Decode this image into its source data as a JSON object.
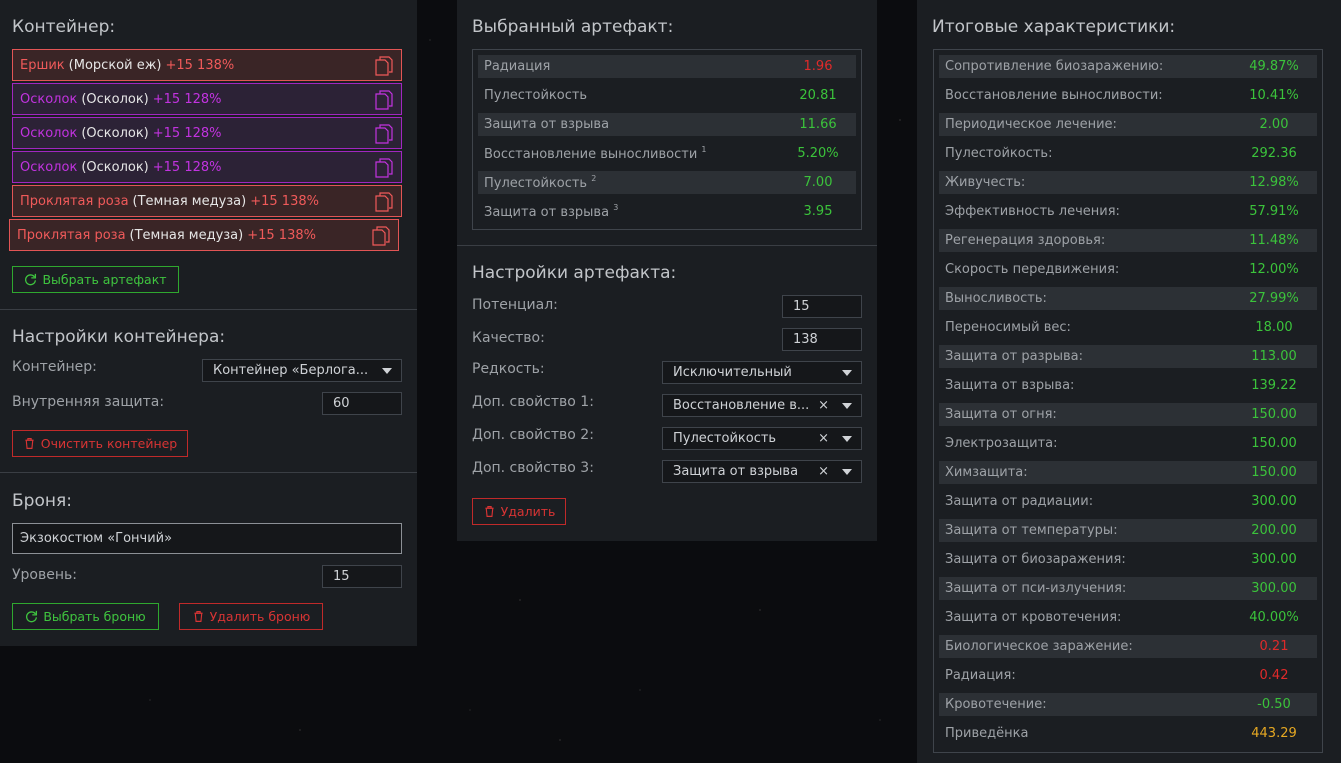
{
  "container_panel": {
    "title": "Контейнер:",
    "artifacts": [
      {
        "name": "Ершик",
        "sub": "(Морской еж)",
        "bonus": "+15 138%",
        "color": "red"
      },
      {
        "name": "Осколок",
        "sub": "(Осколок)",
        "bonus": "+15 128%",
        "color": "purple"
      },
      {
        "name": "Осколок",
        "sub": "(Осколок)",
        "bonus": "+15 128%",
        "color": "purple"
      },
      {
        "name": "Осколок",
        "sub": "(Осколок)",
        "bonus": "+15 128%",
        "color": "purple"
      },
      {
        "name": "Проклятая роза",
        "sub": "(Темная медуза)",
        "bonus": "+15 138%",
        "color": "red"
      },
      {
        "name": "Проклятая роза",
        "sub": "(Темная медуза)",
        "bonus": "+15 138%",
        "color": "red"
      }
    ],
    "select_artifact_label": "Выбрать артефакт",
    "settings_title": "Настройки контейнера:",
    "container_label": "Контейнер:",
    "container_value": "Контейнер «Берлога...",
    "inner_protection_label": "Внутренняя защита:",
    "inner_protection_value": "60",
    "clear_label": "Очистить контейнер",
    "armor_title": "Броня:",
    "armor_value": "Экзокостюм «Гончий»",
    "level_label": "Уровень:",
    "level_value": "15",
    "select_armor_label": "Выбрать броню",
    "delete_armor_label": "Удалить броню"
  },
  "selected_panel": {
    "title": "Выбранный артефакт:",
    "rows": [
      {
        "k": "Радиация",
        "sup": "",
        "v": "1.96",
        "color": "red"
      },
      {
        "k": "Пулестойкость",
        "sup": "",
        "v": "20.81",
        "color": "green"
      },
      {
        "k": "Защита от взрыва",
        "sup": "",
        "v": "11.66",
        "color": "green"
      },
      {
        "k": "Восстановление выносливости",
        "sup": "1",
        "v": "5.20%",
        "color": "green"
      },
      {
        "k": "Пулестойкость",
        "sup": "2",
        "v": "7.00",
        "color": "green"
      },
      {
        "k": "Защита от взрыва",
        "sup": "3",
        "v": "3.95",
        "color": "green"
      }
    ],
    "settings_title": "Настройки артефакта:",
    "potential_label": "Потенциал:",
    "potential_value": "15",
    "quality_label": "Качество:",
    "quality_value": "138",
    "rarity_label": "Редкость:",
    "rarity_value": "Исключительный",
    "prop1_label": "Доп. свойство 1:",
    "prop1_value": "Восстановление в...",
    "prop2_label": "Доп. свойство 2:",
    "prop2_value": "Пулестойкость",
    "prop3_label": "Доп. свойство 3:",
    "prop3_value": "Защита от взрыва",
    "delete_label": "Удалить"
  },
  "totals_panel": {
    "title": "Итоговые характеристики:",
    "rows": [
      {
        "k": "Сопротивление биозаражению:",
        "v": "49.87%",
        "color": "green"
      },
      {
        "k": "Восстановление выносливости:",
        "v": "10.41%",
        "color": "green"
      },
      {
        "k": "Периодическое лечение:",
        "v": "2.00",
        "color": "green"
      },
      {
        "k": "Пулестойкость:",
        "v": "292.36",
        "color": "green"
      },
      {
        "k": "Живучесть:",
        "v": "12.98%",
        "color": "green"
      },
      {
        "k": "Эффективность лечения:",
        "v": "57.91%",
        "color": "green"
      },
      {
        "k": "Регенерация здоровья:",
        "v": "11.48%",
        "color": "green"
      },
      {
        "k": "Скорость передвижения:",
        "v": "12.00%",
        "color": "green"
      },
      {
        "k": "Выносливость:",
        "v": "27.99%",
        "color": "green"
      },
      {
        "k": "Переносимый вес:",
        "v": "18.00",
        "color": "green"
      },
      {
        "k": "Защита от разрыва:",
        "v": "113.00",
        "color": "green"
      },
      {
        "k": "Защита от взрыва:",
        "v": "139.22",
        "color": "green"
      },
      {
        "k": "Защита от огня:",
        "v": "150.00",
        "color": "green"
      },
      {
        "k": "Электрозащита:",
        "v": "150.00",
        "color": "green"
      },
      {
        "k": "Химзащита:",
        "v": "150.00",
        "color": "green"
      },
      {
        "k": "Защита от радиации:",
        "v": "300.00",
        "color": "green"
      },
      {
        "k": "Защита от температуры:",
        "v": "200.00",
        "color": "green"
      },
      {
        "k": "Защита от биозаражения:",
        "v": "300.00",
        "color": "green"
      },
      {
        "k": "Защита от пси-излучения:",
        "v": "300.00",
        "color": "green"
      },
      {
        "k": "Защита от кровотечения:",
        "v": "40.00%",
        "color": "green"
      },
      {
        "k": "Биологическое заражение:",
        "v": "0.21",
        "color": "red"
      },
      {
        "k": "Радиация:",
        "v": "0.42",
        "color": "red"
      },
      {
        "k": "Кровотечение:",
        "v": "-0.50",
        "color": "green"
      },
      {
        "k": "Приведёнка",
        "v": "443.29",
        "color": "gold"
      }
    ]
  }
}
